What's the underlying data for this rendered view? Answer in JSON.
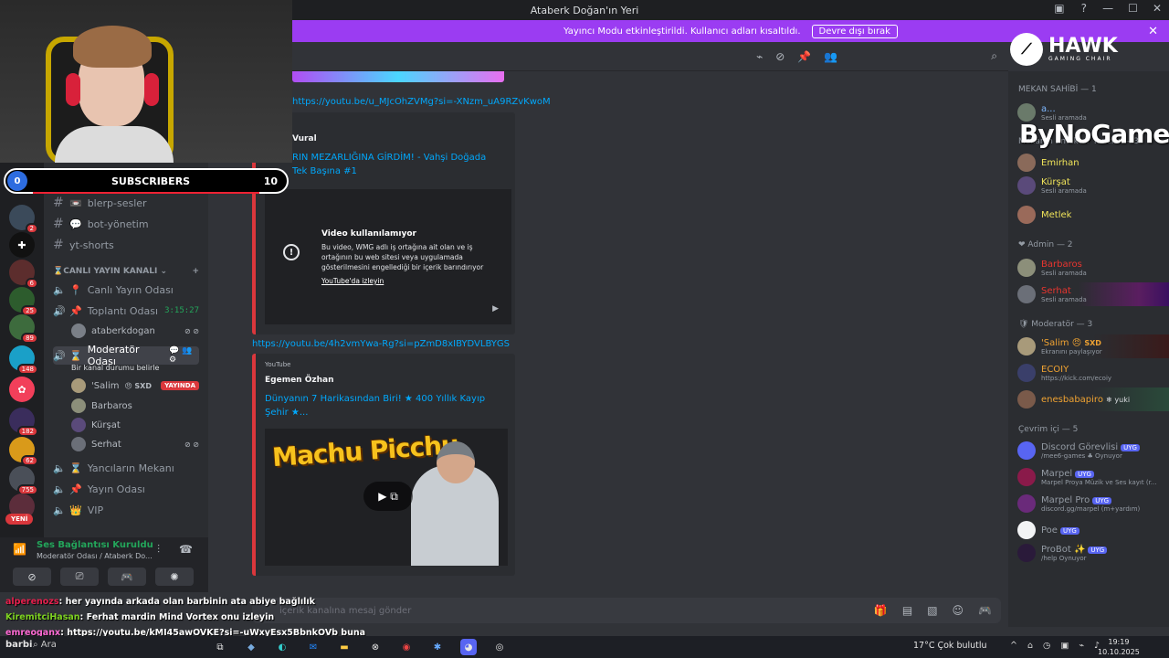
{
  "window": {
    "title": "Ataberk Doğan'ın Yeri",
    "notice_text": "Yayıncı Modu etkinleştirildi. Kullanıcı adları kısaltıldı.",
    "notice_button": "Devre dışı bırak"
  },
  "overlay": {
    "subs_left": "0",
    "subs_label": "SUBSCRIBERS",
    "subs_right": "10",
    "hawk_brand": "HAWK",
    "hawk_sub": "GAMING CHAIR",
    "bynogame": "ByNoGame"
  },
  "rail": {
    "badges": [
      "2",
      "6",
      "25",
      "89",
      "148",
      "182",
      "62",
      "755"
    ],
    "new_label": "YENİ"
  },
  "sidebar": {
    "channels": {
      "tw_bit": "tw-bit",
      "blerp": "blerp-sesler",
      "bot": "bot-yönetim",
      "yt": "yt-shorts"
    },
    "category_live": "CANLI YAYIN KANALI",
    "voice": {
      "live_room": "Canlı Yayın Odası",
      "meeting": "Toplantı Odası",
      "meeting_timer": "3:15:27",
      "meeting_member": "ataberkdogan",
      "mod_room": "Moderatör Odası",
      "mod_status": "Bir kanal durumu belirle",
      "mod_members": [
        {
          "name": "'Salim",
          "extra": "SXD",
          "live": "YAYINDA"
        },
        {
          "name": "Barbaros"
        },
        {
          "name": "Kürşat"
        },
        {
          "name": "Serhat"
        }
      ],
      "partners": "Yancıların Mekanı",
      "stream_room": "Yayın Odası",
      "vip": "VIP"
    }
  },
  "voice_panel": {
    "title": "Ses Bağlantısı Kuruldu",
    "subtitle": "Moderatör Odası / Ataberk Do..."
  },
  "user_panel": {
    "name": "Barbaros"
  },
  "chat": {
    "gradient_link": "https://youtu.be/u_MJcOhZVMg?si=-XNzm_uA9RZvKwoM",
    "embed1": {
      "author": "Vural",
      "title": "RIN MEZARLIĞINA GİRDİM! - Vahşi Doğada Tek Başına #1",
      "unavail_title": "Video kullanılamıyor",
      "unavail_desc": "Bu video, WMG adlı iş ortağına ait olan ve iş ortağının bu web sitesi veya uygulamada gösterilmesini engellediği bir içerik barındırıyor",
      "unavail_link": "YouTube'da izleyin"
    },
    "link2": "https://youtu.be/4h2vmYwa-Rg?si=pZmD8xIBYDVLBYGS",
    "embed2": {
      "provider": "YouTube",
      "author": "Egemen Özhan",
      "title": "Dünyanın 7 Harikasından Biri! ★ 400 Yıllık Kayıp Şehir ★...",
      "thumb_text": "Machu Picchu"
    },
    "composer_placeholder": "içerik kanalına mesaj gönder"
  },
  "members": {
    "groups": {
      "owner": "MEKAN SAHİBİ — 1",
      "elders": "Mekanın Emektar Yancısı — 3",
      "admin": "Admin — 2",
      "mod": "Moderatör — 3",
      "online": "Çevrim içi — 5"
    },
    "owner": {
      "name": "a...",
      "status": "Sesli aramada"
    },
    "elders": [
      {
        "name": "Emirhan"
      },
      {
        "name": "Kürşat",
        "status": "Sesli aramada"
      },
      {
        "name": "Metlek"
      }
    ],
    "admins": [
      {
        "name": "Barbaros",
        "status": "Sesli aramada"
      },
      {
        "name": "Serhat",
        "status": "Sesli aramada"
      }
    ],
    "mods": [
      {
        "name": "'Salim",
        "extra": "SXD",
        "status": "Ekranını paylaşıyor"
      },
      {
        "name": "ECOIY",
        "status": "https://kick.com/ecoiy"
      },
      {
        "name": "enesbabapiro",
        "extra": "yuki"
      }
    ],
    "online": [
      {
        "name": "Discord Görevlisi",
        "tag": "UYG",
        "status": "/mee6-games ♣ Oynuyor"
      },
      {
        "name": "Marpel",
        "tag": "UYG",
        "status": "Marpel Proya Müzik ve Ses kayıt (r..."
      },
      {
        "name": "Marpel Pro",
        "tag": "UYG",
        "status": "discord.gg/marpel (m+yardım)"
      },
      {
        "name": "Poe",
        "tag": "UYG"
      },
      {
        "name": "ProBot",
        "tag": "UYG",
        "status": "/help Oynuyor"
      }
    ]
  },
  "stream_chat": [
    {
      "user": "alperenozs",
      "msg": ": her yayında arkada olan barbinin ata abiye bağlılık"
    },
    {
      "user": "KiremitciHasan",
      "msg": ": Ferhat mardin Mind Vortex onu izleyin"
    },
    {
      "user": "emreoganx",
      "msg": ": https://youtu.be/kMI45awOVKE?si=-uWxyEsx5BbnkOVb buna bak"
    }
  ],
  "taskbar": {
    "search": "Ara",
    "left_text": "barbi",
    "weather": "17°C  Çok bulutlu",
    "time": "19:19",
    "date": "10.10.2025"
  }
}
